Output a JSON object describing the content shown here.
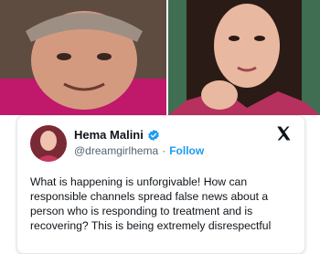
{
  "tweet": {
    "author_name": "Hema Malini",
    "handle": "@dreamgirlhema",
    "separator": "·",
    "follow_label": "Follow",
    "text": "What is happening is unforgivable! How can responsible channels spread false news about a person who is responding to treatment and is recovering? This is being extremely disrespectful"
  },
  "colors": {
    "accent": "#1d9bf0",
    "text": "#0f1419",
    "muted": "#536471"
  },
  "icons": {
    "verified": "verified-badge-icon",
    "platform": "x-logo-icon"
  }
}
